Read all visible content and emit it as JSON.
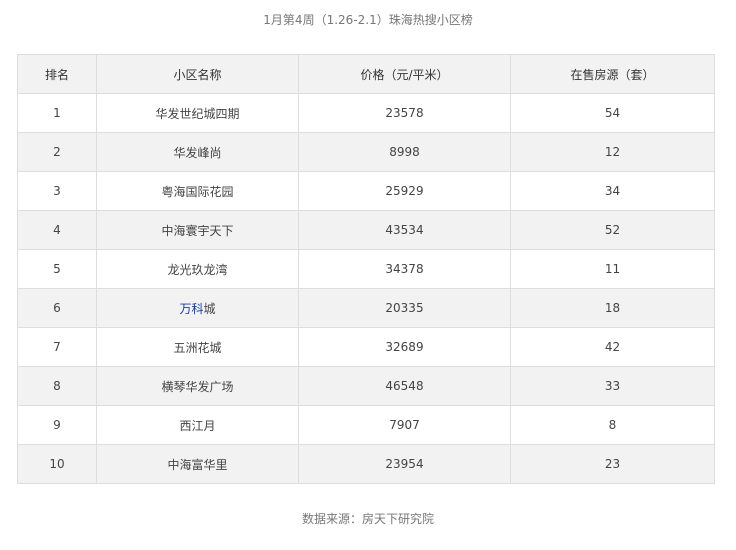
{
  "caption": "1月第4周（1.26-2.1）珠海热搜小区榜",
  "table": {
    "headers": [
      "排名",
      "小区名称",
      "价格（元/平米）",
      "在售房源（套）"
    ],
    "rows": [
      {
        "rank": "1",
        "name_pre": "华发世纪城四期",
        "name_link": "",
        "name_post": "",
        "price": "23578",
        "listings": "54"
      },
      {
        "rank": "2",
        "name_pre": "华发峰尚",
        "name_link": "",
        "name_post": "",
        "price": "8998",
        "listings": "12"
      },
      {
        "rank": "3",
        "name_pre": "粤海国际花园",
        "name_link": "",
        "name_post": "",
        "price": "25929",
        "listings": "34"
      },
      {
        "rank": "4",
        "name_pre": "中海寰宇天下",
        "name_link": "",
        "name_post": "",
        "price": "43534",
        "listings": "52"
      },
      {
        "rank": "5",
        "name_pre": "龙光玖龙湾",
        "name_link": "",
        "name_post": "",
        "price": "34378",
        "listings": "11"
      },
      {
        "rank": "6",
        "name_pre": "",
        "name_link": "万科",
        "name_post": "城",
        "price": "20335",
        "listings": "18"
      },
      {
        "rank": "7",
        "name_pre": "五洲花城",
        "name_link": "",
        "name_post": "",
        "price": "32689",
        "listings": "42"
      },
      {
        "rank": "8",
        "name_pre": "横琴华发广场",
        "name_link": "",
        "name_post": "",
        "price": "46548",
        "listings": "33"
      },
      {
        "rank": "9",
        "name_pre": "西江月",
        "name_link": "",
        "name_post": "",
        "price": "7907",
        "listings": "8"
      },
      {
        "rank": "10",
        "name_pre": "中海富华里",
        "name_link": "",
        "name_post": "",
        "price": "23954",
        "listings": "23"
      }
    ]
  },
  "footer": "数据来源：房天下研究院",
  "colors": {
    "header_bg": "#f2f2f2",
    "stripe_bg": "#f2f2f2",
    "border": "#dddddd",
    "link": "#1a3e9b"
  }
}
